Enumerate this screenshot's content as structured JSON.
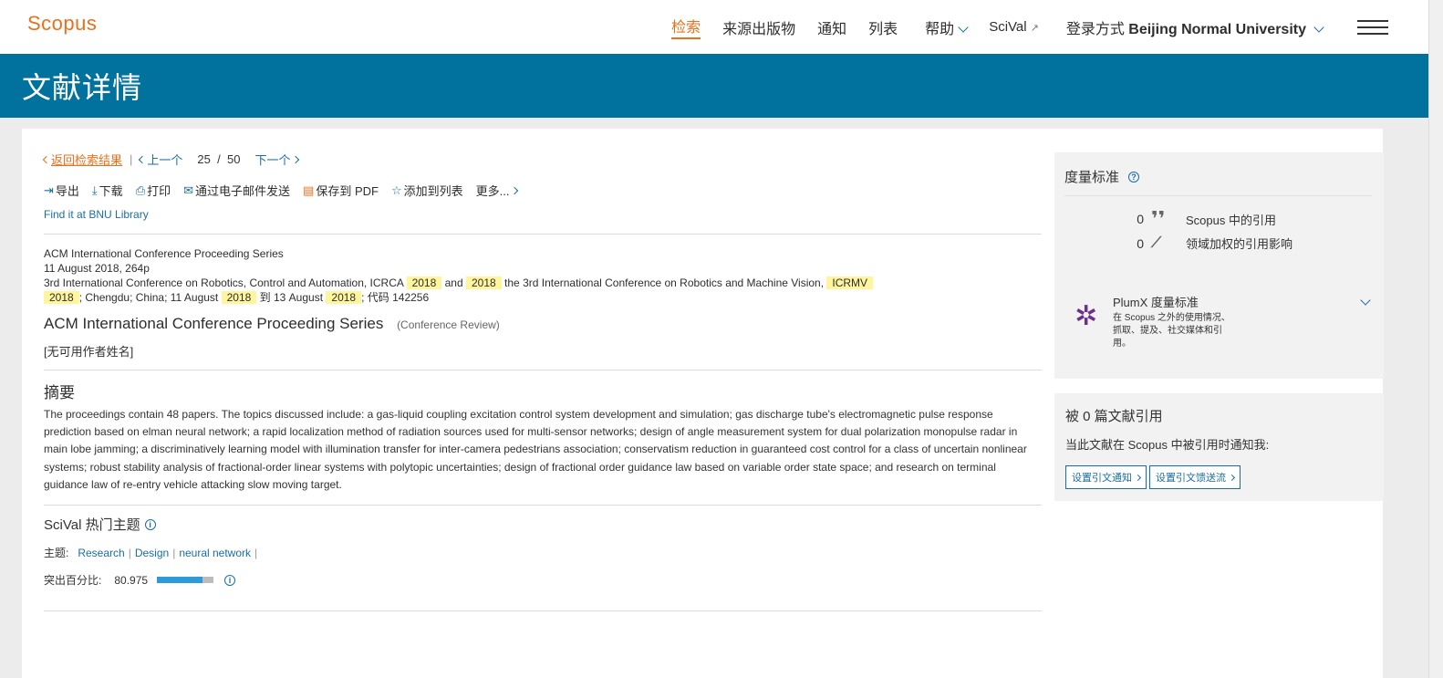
{
  "header": {
    "logo": "Scopus",
    "nav": {
      "search": "检索",
      "sources": "来源出版物",
      "alerts": "通知",
      "lists": "列表",
      "help": "帮助",
      "scival": "SciVal",
      "scival_ext": "↗",
      "login_prefix": "登录方式",
      "login_institution": "Beijing Normal University"
    }
  },
  "page_title": "文献详情",
  "breadcrumb": {
    "back": "返回检索结果",
    "prev": "上一个",
    "current": "25",
    "slash": "/",
    "total": "50",
    "next": "下一个"
  },
  "toolbar": {
    "export": "导出",
    "download": "下载",
    "print": "打印",
    "email": "通过电子邮件发送",
    "save_pdf": "保存到 PDF",
    "add_list": "添加到列表",
    "more": "更多..."
  },
  "find_it": "Find it at BNU Library",
  "source": {
    "series": "ACM International Conference Proceeding Series",
    "date_pages": "11 August 2018, 264p",
    "conf_1": "3rd International Conference on Robotics, Control and Automation, ICRCA",
    "hl_1": "2018",
    "and": "and",
    "hl_2": "2018",
    "conf_2": "the 3rd International Conference on Robotics and Machine Vision,",
    "hl_3": "ICRMV",
    "hl_4": "2018",
    "loc": "; Chengdu; China; 11 August",
    "hl_5": "2018",
    "to": "到 13 August",
    "hl_6": "2018",
    "code": "; 代码 142256"
  },
  "document": {
    "title": "ACM International Conference Proceeding Series",
    "type": "(Conference Review)",
    "authors": "[无可用作者姓名]"
  },
  "abstract": {
    "heading": "摘要",
    "text": "The proceedings contain 48 papers. The topics discussed include: a gas-liquid coupling excitation control system development and simulation; gas discharge tube's electromagnetic pulse response prediction based on elman neural network; a rapid localization method of radiation sources used for multi-sensor networks; design of angle measurement system for dual polarization monopulse radar in main lobe jamming; a discriminatively learning model with illumination transfer for inter-camera pedestrians association; conservatism reduction in guaranteed cost control for a class of uncertain nonlinear systems; robust stability analysis of fractional-order linear systems with polytopic uncertainties; design of fractional order guidance law based on variable order state space; and research on terminal guidance law of re-entry vehicle attacking slow moving target."
  },
  "scival": {
    "heading": "SciVal 热门主题",
    "topics_label": "主题:",
    "topics": [
      "Research",
      "Design",
      "neural network"
    ],
    "pipe": "|",
    "prominence_label": "突出百分比:",
    "prominence_value": "80.975",
    "prominence_pct": 80.975
  },
  "metrics": {
    "heading": "度量标准",
    "citations_count": "0",
    "citations_label": "Scopus 中的引用",
    "fwci_count": "0",
    "fwci_label": "领域加权的引用影响",
    "plumx_title": "PlumX 度量标准",
    "plumx_desc": "在 Scopus 之外的使用情况、抓取、提及、社交媒体和引用。"
  },
  "cited_by": {
    "heading": "被 0 篇文献引用",
    "desc": "当此文献在 Scopus 中被引用时通知我:",
    "alert_btn": "设置引文通知",
    "feed_btn": "设置引文馈送流"
  }
}
